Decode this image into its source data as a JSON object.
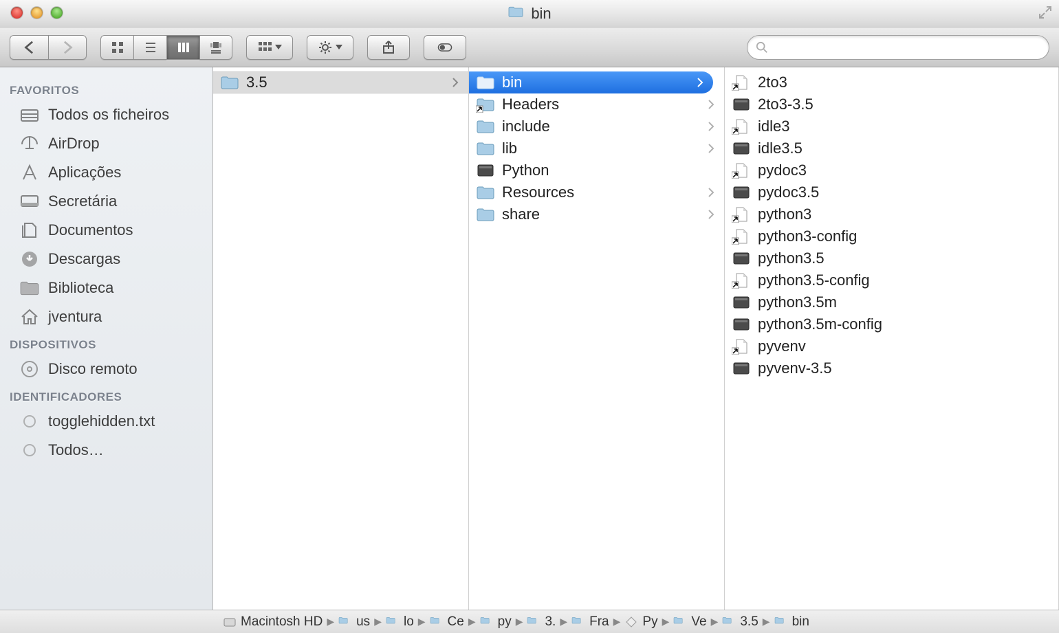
{
  "window": {
    "title": "bin"
  },
  "search": {
    "placeholder": ""
  },
  "sidebar": {
    "sections": [
      {
        "header": "FAVORITOS",
        "items": [
          {
            "icon": "all-files-icon",
            "label": "Todos os ficheiros"
          },
          {
            "icon": "airdrop-icon",
            "label": "AirDrop"
          },
          {
            "icon": "applications-icon",
            "label": "Aplicações"
          },
          {
            "icon": "desktop-icon",
            "label": "Secretária"
          },
          {
            "icon": "documents-icon",
            "label": "Documentos"
          },
          {
            "icon": "downloads-icon",
            "label": "Descargas"
          },
          {
            "icon": "folder-icon",
            "label": "Biblioteca"
          },
          {
            "icon": "home-icon",
            "label": "jventura"
          }
        ]
      },
      {
        "header": "DISPOSITIVOS",
        "items": [
          {
            "icon": "disc-icon",
            "label": "Disco remoto"
          }
        ]
      },
      {
        "header": "IDENTIFICADORES",
        "items": [
          {
            "icon": "tag-icon",
            "label": "togglehidden.txt"
          },
          {
            "icon": "tag-icon",
            "label": "Todos…"
          }
        ]
      }
    ]
  },
  "columns": [
    {
      "items": [
        {
          "icon": "folder",
          "label": "3.5",
          "arrow": true,
          "selected": "gray"
        }
      ]
    },
    {
      "items": [
        {
          "icon": "folder",
          "label": "bin",
          "arrow": true,
          "selected": "blue"
        },
        {
          "icon": "alias-folder",
          "label": "Headers",
          "arrow": true
        },
        {
          "icon": "folder",
          "label": "include",
          "arrow": true
        },
        {
          "icon": "folder",
          "label": "lib",
          "arrow": true
        },
        {
          "icon": "exec",
          "label": "Python",
          "arrow": false
        },
        {
          "icon": "folder",
          "label": "Resources",
          "arrow": true
        },
        {
          "icon": "folder",
          "label": "share",
          "arrow": true
        }
      ]
    },
    {
      "items": [
        {
          "icon": "alias-doc",
          "label": "2to3"
        },
        {
          "icon": "exec",
          "label": "2to3-3.5"
        },
        {
          "icon": "alias-doc",
          "label": "idle3"
        },
        {
          "icon": "exec",
          "label": "idle3.5"
        },
        {
          "icon": "alias-doc",
          "label": "pydoc3"
        },
        {
          "icon": "exec",
          "label": "pydoc3.5"
        },
        {
          "icon": "alias-doc",
          "label": "python3"
        },
        {
          "icon": "alias-doc",
          "label": "python3-config"
        },
        {
          "icon": "exec",
          "label": "python3.5"
        },
        {
          "icon": "alias-doc",
          "label": "python3.5-config"
        },
        {
          "icon": "exec",
          "label": "python3.5m"
        },
        {
          "icon": "exec",
          "label": "python3.5m-config"
        },
        {
          "icon": "alias-doc",
          "label": "pyvenv"
        },
        {
          "icon": "exec",
          "label": "pyvenv-3.5"
        }
      ]
    }
  ],
  "pathbar": [
    {
      "icon": "hd",
      "label": "Macintosh HD"
    },
    {
      "icon": "folder",
      "label": "us"
    },
    {
      "icon": "folder",
      "label": "lo"
    },
    {
      "icon": "folder",
      "label": "Ce"
    },
    {
      "icon": "folder",
      "label": "py"
    },
    {
      "icon": "folder",
      "label": "3."
    },
    {
      "icon": "folder",
      "label": "Fra"
    },
    {
      "icon": "app",
      "label": "Py"
    },
    {
      "icon": "folder",
      "label": "Ve"
    },
    {
      "icon": "folder",
      "label": "3.5"
    },
    {
      "icon": "folder",
      "label": "bin"
    }
  ]
}
